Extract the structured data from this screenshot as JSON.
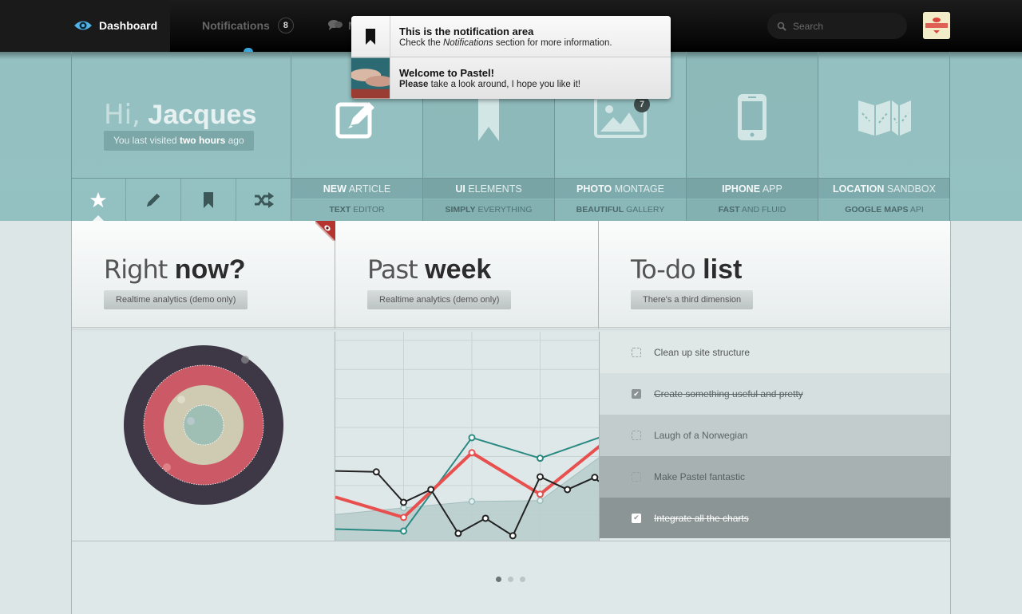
{
  "topnav": {
    "items": [
      {
        "label": "Dashboard",
        "icon": "eye-icon",
        "active": true
      },
      {
        "label": "Notifications",
        "badge": "8",
        "icon": null
      },
      {
        "label": "M",
        "icon": "chat-bubbles-icon"
      }
    ],
    "search": {
      "placeholder": "Search",
      "value": ""
    },
    "avatar": "user-avatar"
  },
  "notifications": [
    {
      "icon": "bookmark-icon",
      "title": "This is the notification area",
      "body_pre": "Check the ",
      "body_em": "Notifications",
      "body_post": " section for more information."
    },
    {
      "icon": "clouds-thumbnail",
      "title": "Welcome to Pastel!",
      "body_bold": "Please",
      "body_post": " take a look around, I hope you like it!"
    }
  ],
  "hero": {
    "greeting_prefix": "Hi,",
    "name": "Jacques",
    "last_visit_pre": "You last visited ",
    "last_visit_bold": "two hours",
    "last_visit_post": " ago",
    "icon_tabs": [
      {
        "icon": "star-icon",
        "active": true
      },
      {
        "icon": "pencil-icon"
      },
      {
        "icon": "bookmark-icon"
      },
      {
        "icon": "shuffle-icon"
      }
    ],
    "tiles": [
      {
        "icon": "edit-icon",
        "title_bold": "NEW",
        "title": " ARTICLE",
        "sub_bold": "TEXT",
        "sub": " EDITOR"
      },
      {
        "icon": "ribbon-icon",
        "title_bold": "UI",
        "title": " ELEMENTS",
        "sub_bold": "SIMPLY",
        "sub": " EVERYTHING"
      },
      {
        "icon": "image-icon",
        "count": "7",
        "title_bold": "PHOTO",
        "title": " MONTAGE",
        "sub_bold": "BEAUTIFUL",
        "sub": " GALLERY"
      },
      {
        "icon": "phone-icon",
        "title_bold": "IPHONE",
        "title": " APP",
        "sub_bold": "FAST",
        "sub": " AND FLUID"
      },
      {
        "icon": "map-icon",
        "title_bold": "LOCATION",
        "title": " SANDBOX",
        "sub_bold": "GOOGLE MAPS",
        "sub": " API"
      }
    ]
  },
  "panels": [
    {
      "title_light": "Right",
      "title_bold": "now?",
      "button": "Realtime analytics (demo only)"
    },
    {
      "title_light": "Past",
      "title_bold": "week",
      "button": "Realtime analytics (demo only)"
    },
    {
      "title_light": "To-do",
      "title_bold": "list",
      "button": "There's a third dimension"
    }
  ],
  "todos": [
    {
      "text": "Clean up site structure",
      "done": false
    },
    {
      "text": "Create something useful and pretty",
      "done": true
    },
    {
      "text": "Laugh of a Norwegian",
      "done": false
    },
    {
      "text": "Make Pastel fantastic",
      "done": false
    },
    {
      "text": "Integrate all the charts",
      "done": true
    }
  ],
  "target_rings": [
    {
      "color": "#3e3745"
    },
    {
      "color": "#cc5a66"
    },
    {
      "color": "#cfcbb2"
    },
    {
      "color": "#9fbfb5"
    }
  ],
  "pager": {
    "count": 3,
    "active": 0
  },
  "chart_data": {
    "type": "line",
    "title": "Past week",
    "x": [
      0,
      1,
      2,
      3,
      4
    ],
    "ylim": [
      0,
      7.2
    ],
    "grid": true,
    "series": [
      {
        "name": "area",
        "kind": "area",
        "color": "#b9cccd",
        "x": [
          0,
          1,
          2,
          3,
          4
        ],
        "values": [
          0.9,
          1.13,
          1.35,
          1.38,
          3.1
        ]
      },
      {
        "name": "teal",
        "kind": "line",
        "color": "#2a8a83",
        "x": [
          0,
          1,
          2,
          3,
          4
        ],
        "values": [
          0.4,
          0.33,
          3.55,
          2.84,
          3.66
        ]
      },
      {
        "name": "red",
        "kind": "line",
        "color": "#e8504f",
        "x": [
          0,
          1,
          2,
          3,
          4
        ],
        "values": [
          1.5,
          0.8,
          3.03,
          1.6,
          3.5
        ]
      },
      {
        "name": "black",
        "kind": "line",
        "color": "#222222",
        "x": [
          0,
          0.6,
          1,
          1.4,
          1.8,
          2.2,
          2.6,
          3,
          3.4,
          3.8,
          3.86
        ],
        "values": [
          2.4,
          2.37,
          1.32,
          1.76,
          0.25,
          0.77,
          0.17,
          2.2,
          1.76,
          2.18,
          2.04
        ]
      }
    ]
  }
}
